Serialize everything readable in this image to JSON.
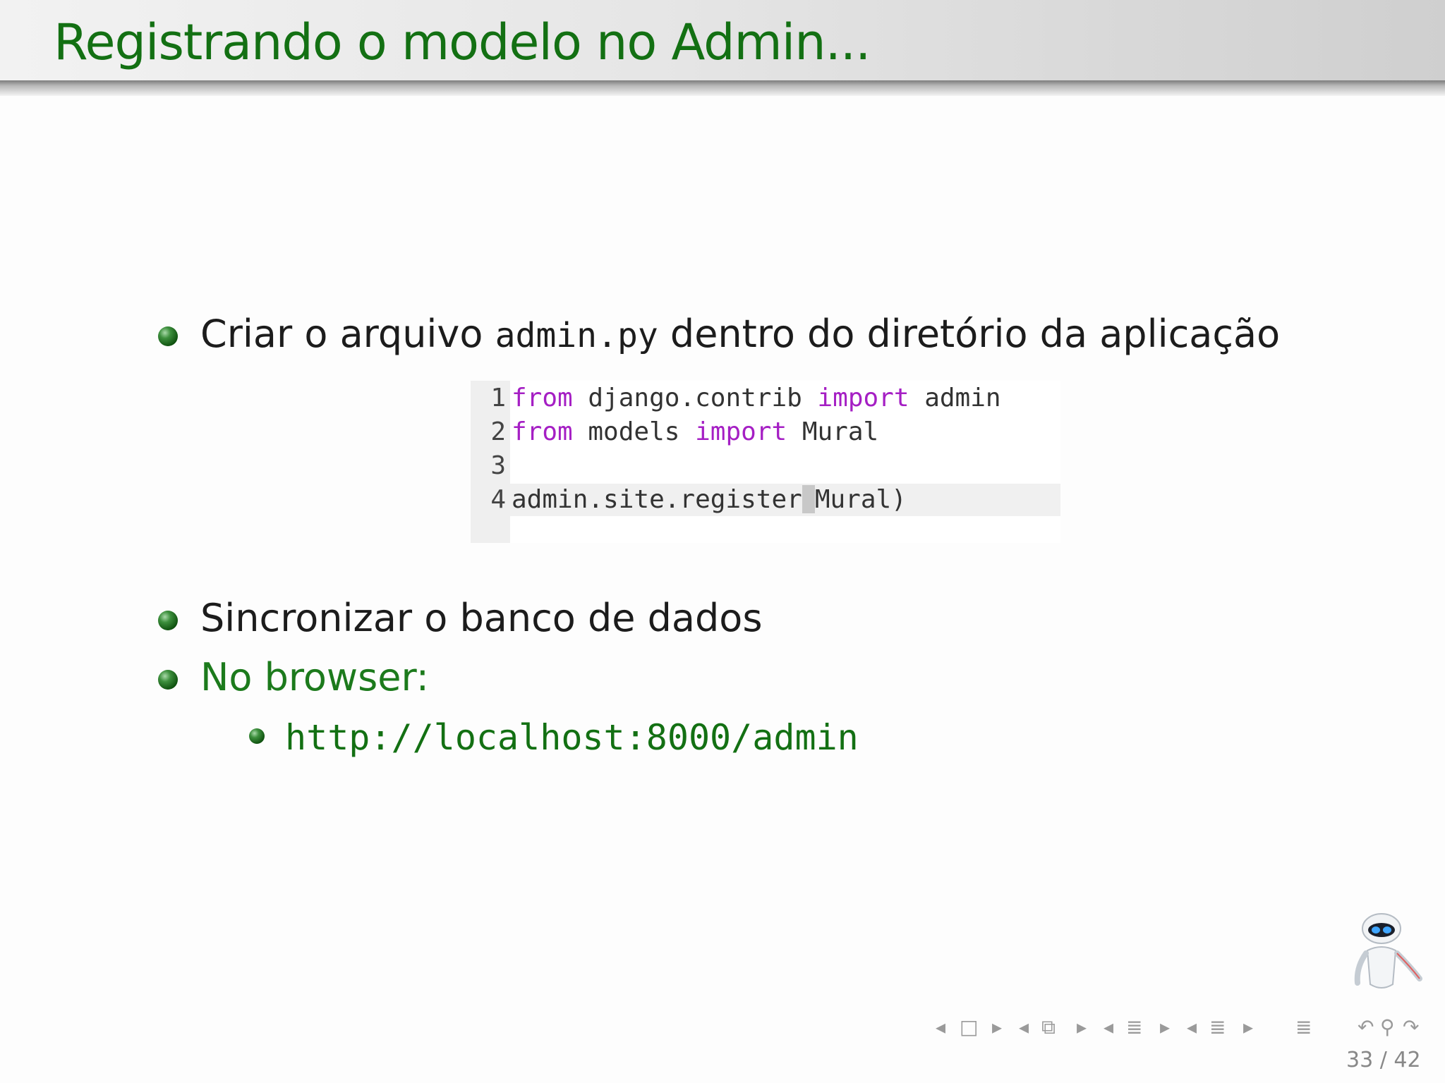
{
  "slide": {
    "title": "Registrando o modelo no Admin...",
    "bullets": [
      {
        "before": "Criar o arquivo ",
        "code": "admin.py",
        "after": " dentro do diretório da aplicação"
      },
      {
        "text": "Sincronizar o banco de dados"
      },
      {
        "text": "No browser:"
      }
    ],
    "sub_bullet": "http://localhost:8000/admin"
  },
  "code_image": {
    "lines": [
      {
        "num": "1",
        "kw1": "from",
        "mid": " django.contrib ",
        "kw2": "import",
        "rest": " admin"
      },
      {
        "num": "2",
        "kw1": "from",
        "mid": " models ",
        "kw2": "import",
        "rest": " Mural"
      },
      {
        "num": "3"
      },
      {
        "num": "4",
        "text_before_cursor": "admin.site.register",
        "text_after_cursor": "Mural)"
      }
    ]
  },
  "navigation": {
    "page_current": "33",
    "page_separator": "/",
    "page_total": "42"
  },
  "colors": {
    "title": "#137013",
    "keyword": "#a51fc4",
    "link": "#137013"
  }
}
